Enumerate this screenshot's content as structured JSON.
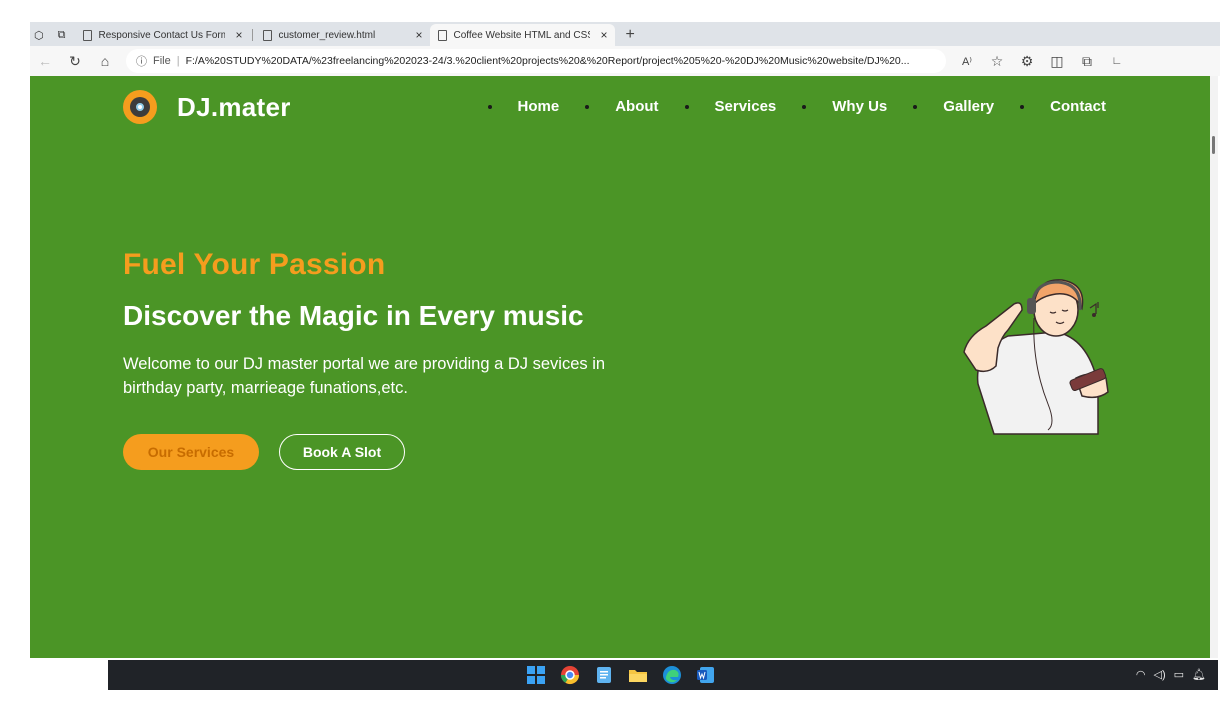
{
  "browser": {
    "tabs": [
      {
        "title": "Responsive Contact Us Form | Co",
        "active": false
      },
      {
        "title": "customer_review.html",
        "active": false
      },
      {
        "title": "Coffee Website HTML and CSS | ",
        "active": true
      }
    ],
    "new_tab": "+",
    "close_glyph": "×",
    "address": {
      "scheme_label": "File",
      "url": "F:/A%20STUDY%20DATA/%23freelancing%202023-24/3.%20client%20projects%20&%20Report/project%205%20-%20DJ%20Music%20website/DJ%20..."
    }
  },
  "site": {
    "brand": "DJ.mater",
    "nav": [
      "Home",
      "About",
      "Services",
      "Why Us",
      "Gallery",
      "Contact"
    ],
    "hero": {
      "kicker": "Fuel Your Passion",
      "headline": "Discover the Magic in Every music",
      "lead": "Welcome to our DJ master portal we are providing a DJ sevices in birthday party, marrieage funations,etc.",
      "primary_button": "Our Services",
      "secondary_button": "Book A Slot"
    }
  },
  "colors": {
    "page_bg": "#4b9526",
    "accent": "#f59d1e",
    "text": "#ffffff"
  },
  "taskbar": {
    "apps": [
      "windows-start-icon",
      "chrome-icon",
      "notepad-icon",
      "file-explorer-icon",
      "edge-icon",
      "word-icon"
    ],
    "tray": [
      "wifi-icon",
      "volume-icon",
      "battery-icon",
      "notification-icon"
    ]
  }
}
